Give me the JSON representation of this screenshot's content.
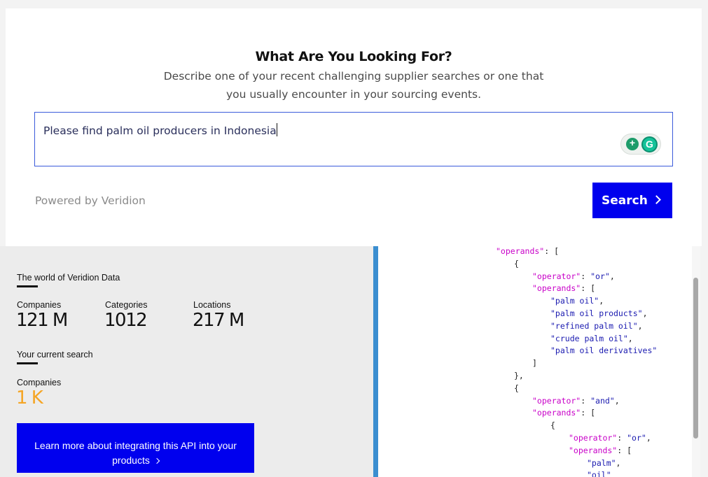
{
  "header": {
    "title": "What Are You Looking For?",
    "subtitle_line1": "Describe one of your recent challenging supplier searches or one that",
    "subtitle_line2": "you usually encounter in your sourcing events."
  },
  "search": {
    "value": "Please find palm oil producers in Indonesia",
    "button_label": "Search"
  },
  "powered_by": "Powered by Veridion",
  "stats": {
    "world_heading": "The world of Veridion Data",
    "companies_label": "Companies",
    "companies_value": "121 M",
    "categories_label": "Categories",
    "categories_value": "1012",
    "locations_label": "Locations",
    "locations_value": "217 M",
    "current_heading": "Your current search",
    "current_companies_label": "Companies",
    "current_companies_value": "1 K"
  },
  "cta": {
    "line1": "Learn more about integrating this API into your",
    "line2": "products"
  },
  "colors": {
    "accent": "#0000ee",
    "orange": "#f5a524",
    "divider": "#3b8ed0"
  },
  "code": [
    {
      "indent": 0,
      "parts": [
        [
          "k",
          "\"operands\""
        ],
        [
          "p",
          ": ["
        ]
      ]
    },
    {
      "indent": 1,
      "parts": [
        [
          "p",
          "{"
        ]
      ]
    },
    {
      "indent": 2,
      "parts": [
        [
          "k",
          "\"operator\""
        ],
        [
          "p",
          ": "
        ],
        [
          "s",
          "\"or\""
        ],
        [
          "p",
          ","
        ]
      ]
    },
    {
      "indent": 2,
      "parts": [
        [
          "k",
          "\"operands\""
        ],
        [
          "p",
          ": ["
        ]
      ]
    },
    {
      "indent": 3,
      "parts": [
        [
          "s",
          "\"palm oil\""
        ],
        [
          "p",
          ","
        ]
      ]
    },
    {
      "indent": 3,
      "parts": [
        [
          "s",
          "\"palm oil products\""
        ],
        [
          "p",
          ","
        ]
      ]
    },
    {
      "indent": 3,
      "parts": [
        [
          "s",
          "\"refined palm oil\""
        ],
        [
          "p",
          ","
        ]
      ]
    },
    {
      "indent": 3,
      "parts": [
        [
          "s",
          "\"crude palm oil\""
        ],
        [
          "p",
          ","
        ]
      ]
    },
    {
      "indent": 3,
      "parts": [
        [
          "s",
          "\"palm oil derivatives\""
        ]
      ]
    },
    {
      "indent": 2,
      "parts": [
        [
          "p",
          "]"
        ]
      ]
    },
    {
      "indent": 1,
      "parts": [
        [
          "p",
          "},"
        ]
      ]
    },
    {
      "indent": 1,
      "parts": [
        [
          "p",
          "{"
        ]
      ]
    },
    {
      "indent": 2,
      "parts": [
        [
          "k",
          "\"operator\""
        ],
        [
          "p",
          ": "
        ],
        [
          "s",
          "\"and\""
        ],
        [
          "p",
          ","
        ]
      ]
    },
    {
      "indent": 2,
      "parts": [
        [
          "k",
          "\"operands\""
        ],
        [
          "p",
          ": ["
        ]
      ]
    },
    {
      "indent": 3,
      "parts": [
        [
          "p",
          "{"
        ]
      ]
    },
    {
      "indent": 4,
      "parts": [
        [
          "k",
          "\"operator\""
        ],
        [
          "p",
          ": "
        ],
        [
          "s",
          "\"or\""
        ],
        [
          "p",
          ","
        ]
      ]
    },
    {
      "indent": 4,
      "parts": [
        [
          "k",
          "\"operands\""
        ],
        [
          "p",
          ": ["
        ]
      ]
    },
    {
      "indent": 5,
      "parts": [
        [
          "s",
          "\"palm\""
        ],
        [
          "p",
          ","
        ]
      ]
    },
    {
      "indent": 5,
      "parts": [
        [
          "s",
          "\"oil\""
        ]
      ]
    }
  ]
}
